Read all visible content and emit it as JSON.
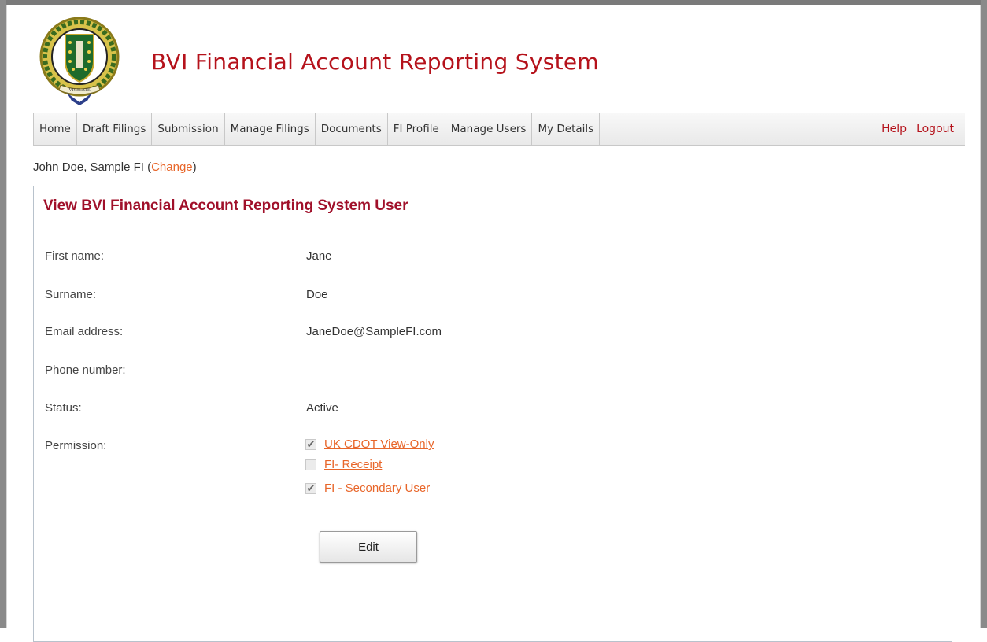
{
  "app": {
    "title": "BVI Financial Account Reporting System",
    "logo_text": "VIGILATE"
  },
  "nav": {
    "items": [
      "Home",
      "Draft Filings",
      "Submission",
      "Manage Filings",
      "Documents",
      "FI Profile",
      "Manage Users",
      "My Details"
    ],
    "help": "Help",
    "logout": "Logout"
  },
  "session": {
    "user_prefix": "John Doe, Sample FI (",
    "change_link": "Change",
    "user_suffix": ")"
  },
  "page": {
    "title": "View BVI Financial Account Reporting System User",
    "fields": {
      "first_name_label": "First name:",
      "first_name_value": "Jane",
      "surname_label": "Surname:",
      "surname_value": "Doe",
      "email_label": "Email address:",
      "email_value": "JaneDoe@SampleFI.com",
      "phone_label": "Phone number:",
      "phone_value": "",
      "status_label": "Status:",
      "status_value": "Active",
      "permission_label": "Permission:"
    },
    "permissions": [
      {
        "label": "UK CDOT View-Only",
        "checked": true
      },
      {
        "label": "FI- Receipt",
        "checked": false
      },
      {
        "label": "FI - Secondary User",
        "checked": true
      }
    ],
    "edit_button": "Edit"
  },
  "colors": {
    "title_red": "#b5121b",
    "link_orange": "#e8662a",
    "panel_border": "#b8c2cc"
  }
}
